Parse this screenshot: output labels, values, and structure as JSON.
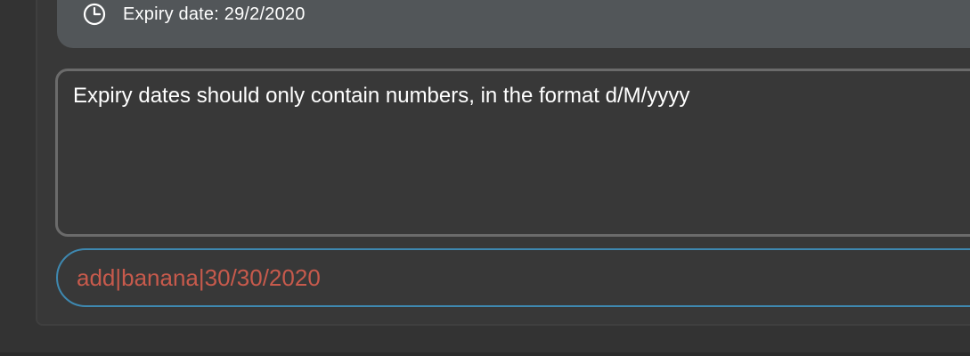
{
  "item": {
    "expiry_label": "Expiry date: 29/2/2020",
    "icon": "clock-icon"
  },
  "result": {
    "message": "Expiry dates should only contain numbers, in the format d/M/yyyy"
  },
  "command": {
    "value": "add|banana|30/30/2020",
    "text_color": "#c75a4c",
    "border_color": "#3e88b0"
  },
  "colors": {
    "background": "#333333",
    "card": "#525659",
    "panel": "#383838"
  }
}
